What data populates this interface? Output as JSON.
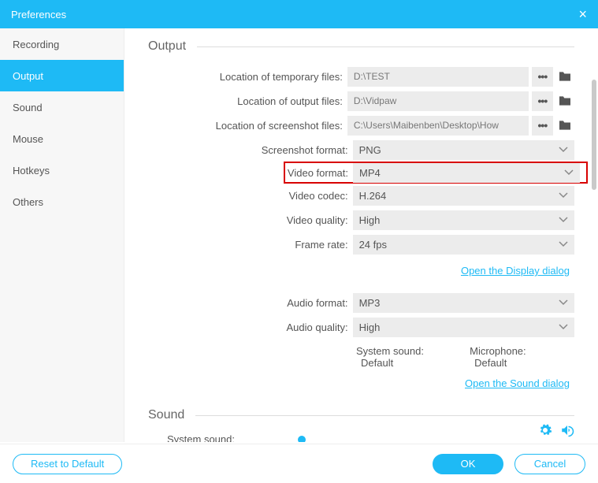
{
  "titlebar": {
    "title": "Preferences"
  },
  "sidebar": {
    "items": [
      {
        "label": "Recording"
      },
      {
        "label": "Output"
      },
      {
        "label": "Sound"
      },
      {
        "label": "Mouse"
      },
      {
        "label": "Hotkeys"
      },
      {
        "label": "Others"
      }
    ],
    "selected_index": 1
  },
  "sections": {
    "output": {
      "title": "Output",
      "temp_files": {
        "label": "Location of temporary files:",
        "value": "D:\\TEST"
      },
      "output_files": {
        "label": "Location of output files:",
        "value": "D:\\Vidpaw"
      },
      "screenshot_files": {
        "label": "Location of screenshot files:",
        "value": "C:\\Users\\Maibenben\\Desktop\\How"
      },
      "screenshot_format": {
        "label": "Screenshot format:",
        "value": "PNG"
      },
      "video_format": {
        "label": "Video format:",
        "value": "MP4"
      },
      "video_codec": {
        "label": "Video codec:",
        "value": "H.264"
      },
      "video_quality": {
        "label": "Video quality:",
        "value": "High"
      },
      "frame_rate": {
        "label": "Frame rate:",
        "value": "24 fps"
      },
      "display_link": "Open the Display dialog",
      "audio_format": {
        "label": "Audio format:",
        "value": "MP3"
      },
      "audio_quality": {
        "label": "Audio quality:",
        "value": "High"
      },
      "system_sound": {
        "label": "System sound:",
        "value": "Default"
      },
      "microphone": {
        "label": "Microphone:",
        "value": "Default"
      },
      "sound_link": "Open the Sound dialog"
    },
    "sound": {
      "title": "Sound",
      "system_sound_label": "System sound:"
    }
  },
  "footer": {
    "reset": "Reset to Default",
    "ok": "OK",
    "cancel": "Cancel"
  },
  "icons": {
    "close": "×"
  }
}
